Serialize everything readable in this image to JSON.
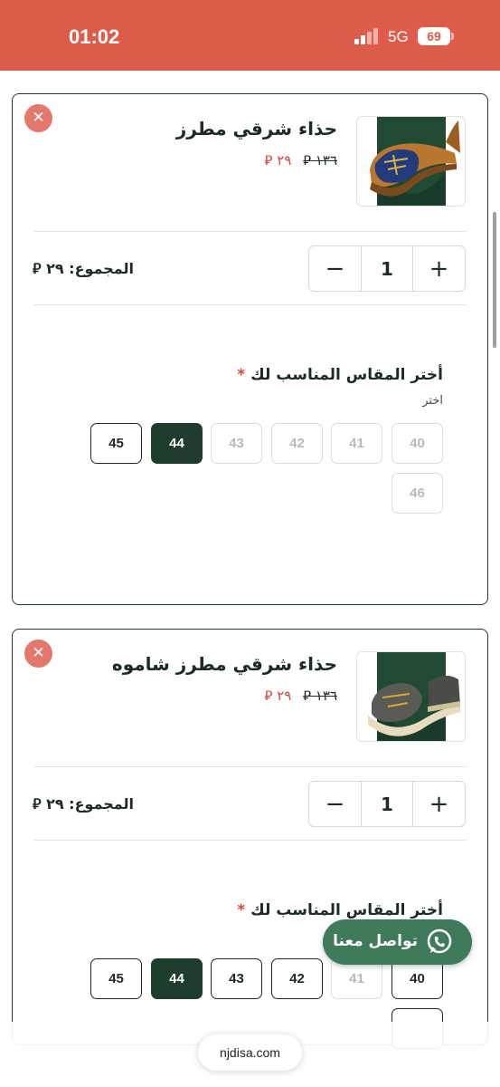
{
  "status_bar": {
    "time": "01:02",
    "network": "5G",
    "battery": "69",
    "signal_bars_active": 2,
    "signal_bars_total": 4
  },
  "colors": {
    "status_bar": "#de5c4a",
    "brand_green": "#1f3d2d",
    "sale_red": "#d9473f",
    "remove_button": "#e5786d",
    "whatsapp_button": "#3f7a5a"
  },
  "cart_items": [
    {
      "remove_icon": "close-icon",
      "title": "حذاء شرقي مطرز",
      "old_price": "١٣٦ ⃁",
      "new_price": "٢٩ ⃁",
      "quantity": "1",
      "minus_label": "−",
      "plus_label": "+",
      "total": "المجموع: ٢٩ ⃁",
      "size_prompt": "أختر المقاس المناسب لك",
      "required_mark": "*",
      "size_hint": "اختر",
      "sizes": [
        {
          "label": "40",
          "state": "disabled"
        },
        {
          "label": "41",
          "state": "disabled"
        },
        {
          "label": "42",
          "state": "disabled"
        },
        {
          "label": "43",
          "state": "disabled"
        },
        {
          "label": "44",
          "state": "selected"
        },
        {
          "label": "45",
          "state": "available"
        },
        {
          "label": "46",
          "state": "disabled"
        }
      ]
    },
    {
      "remove_icon": "close-icon",
      "title": "حذاء شرقي مطرز شاموه",
      "old_price": "١٣٦ ⃁",
      "new_price": "٢٩ ⃁",
      "quantity": "1",
      "minus_label": "−",
      "plus_label": "+",
      "total": "المجموع: ٢٩ ⃁",
      "size_prompt": "أختر المقاس المناسب لك",
      "required_mark": "*",
      "sizes": [
        {
          "label": "40",
          "state": "available"
        },
        {
          "label": "41",
          "state": "disabled"
        },
        {
          "label": "42",
          "state": "available"
        },
        {
          "label": "43",
          "state": "available"
        },
        {
          "label": "44",
          "state": "selected"
        },
        {
          "label": "45",
          "state": "available"
        }
      ]
    }
  ],
  "whatsapp": {
    "label": "تواصل معنا",
    "icon": "whatsapp-icon"
  },
  "url_bar": {
    "url": "njdisa.com"
  }
}
